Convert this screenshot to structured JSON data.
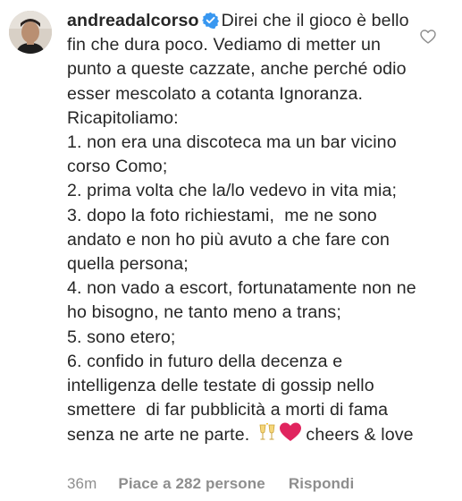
{
  "comment": {
    "username": "andreadalcorso",
    "verified_icon": "verified-badge-icon",
    "text": "Direi che il gioco è bello fin che dura poco. Vediamo di metter un punto a queste cazzate, anche perché odio esser mescolato a cotanta Ignoranza.\nRicapitoliamo:\n1. non era una discoteca ma un bar vicino corso Como;\n2. prima volta che la/lo vedevo in vita mia;\n3. dopo la foto richiestami,  me ne sono andato e non ho più avuto a che fare con quella persona;\n4. non vado a escort, fortunatamente non ne ho bisogno, ne tanto meno a trans;\n5. sono etero;\n6. confido in futuro della decenza e intelligenza delle testate di gossip nello smettere  di far pubblicità a morti di fama senza ne arte ne parte.",
    "emojis": [
      "clinking-glasses-emoji",
      "red-heart-emoji"
    ],
    "text_end": " cheers & love"
  },
  "meta": {
    "time": "36m",
    "likes": "Piace a 282 persone",
    "reply": "Rispondi"
  },
  "icons": {
    "like": "heart-outline-icon",
    "avatar": "profile-avatar"
  },
  "colors": {
    "text": "#262626",
    "secondary": "#8e8e8e",
    "verified": "#3897f0",
    "heart_emoji": "#e0245e"
  }
}
